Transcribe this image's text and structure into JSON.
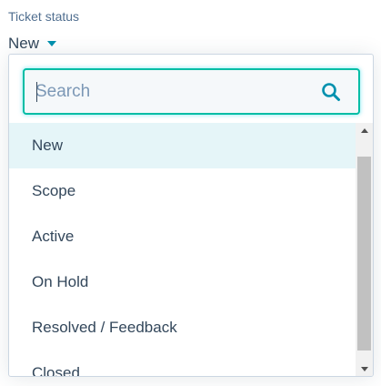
{
  "field": {
    "label": "Ticket status",
    "selected_value": "New"
  },
  "search": {
    "placeholder": "Search",
    "value": ""
  },
  "options": [
    {
      "label": "New",
      "selected": true
    },
    {
      "label": "Scope",
      "selected": false
    },
    {
      "label": "Active",
      "selected": false
    },
    {
      "label": "On Hold",
      "selected": false
    },
    {
      "label": "Resolved / Feedback",
      "selected": false
    },
    {
      "label": "Closed",
      "selected": false
    }
  ],
  "colors": {
    "accent": "#0091ae",
    "focus_border": "#00bda5",
    "selected_bg": "#e5f5f8",
    "text": "#33475b",
    "label": "#516f90"
  },
  "icons": {
    "dropdown_caret": "caret-down-icon",
    "search": "search-icon",
    "scroll_up": "scroll-up-arrow-icon",
    "scroll_down": "scroll-down-arrow-icon"
  }
}
